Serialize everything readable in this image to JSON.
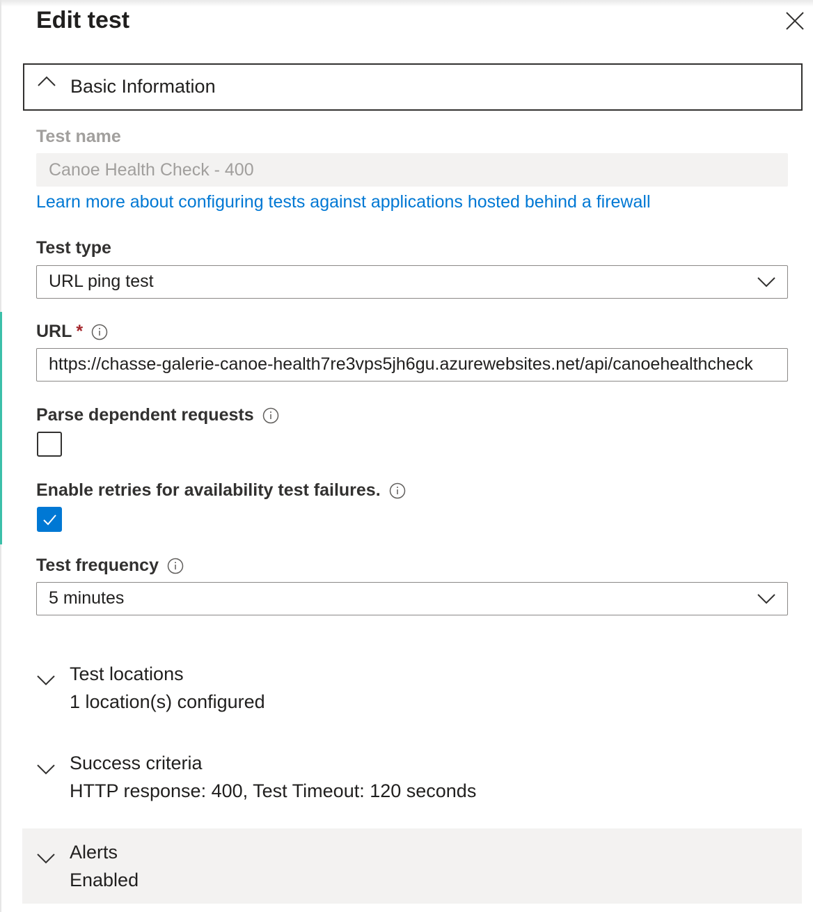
{
  "panel": {
    "title": "Edit test"
  },
  "basic_info": {
    "header_label": "Basic Information"
  },
  "test_name": {
    "label": "Test name",
    "value": "Canoe Health Check - 400"
  },
  "firewall_link": "Learn more about configuring tests against applications hosted behind a firewall",
  "test_type": {
    "label": "Test type",
    "value": "URL ping test"
  },
  "url": {
    "label": "URL",
    "required_mark": "*",
    "value": "https://chasse-galerie-canoe-health7re3vps5jh6gu.azurewebsites.net/api/canoehealthcheck"
  },
  "parse_dependent": {
    "label": "Parse dependent requests",
    "checked": false
  },
  "enable_retries": {
    "label": "Enable retries for availability test failures.",
    "checked": true
  },
  "test_frequency": {
    "label": "Test frequency",
    "value": "5 minutes"
  },
  "sections": {
    "test_locations": {
      "title": "Test locations",
      "summary": "1 location(s) configured"
    },
    "success_criteria": {
      "title": "Success criteria",
      "summary": "HTTP response: 400, Test Timeout: 120 seconds"
    },
    "alerts": {
      "title": "Alerts",
      "summary": "Enabled"
    }
  },
  "colors": {
    "accent_blue": "#0078d4",
    "required_red": "#a4262c",
    "disabled_text": "#a19f9d",
    "disabled_bg": "#f3f2f1"
  }
}
